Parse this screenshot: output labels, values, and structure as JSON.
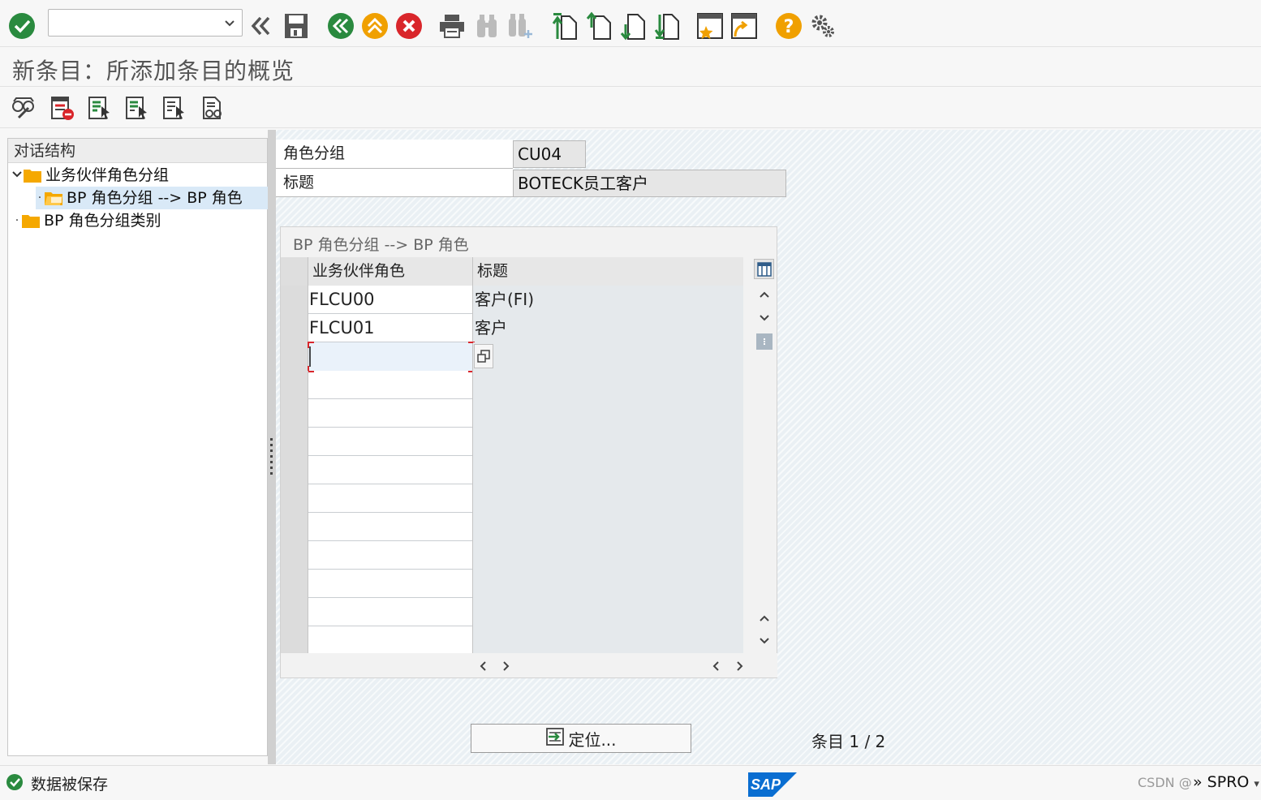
{
  "window": {
    "title": "新条目：所添加条目的概览"
  },
  "command_field": {
    "value": ""
  },
  "toolbar": {
    "icons": [
      "enter-icon",
      "back-double-icon",
      "save-icon",
      "back-icon",
      "exit-icon",
      "cancel-icon",
      "print-icon",
      "find-icon",
      "find-next-icon",
      "first-page-icon",
      "previous-page-icon",
      "next-page-icon",
      "last-page-icon",
      "create-session-icon",
      "generate-shortcut-icon",
      "help-icon",
      "settings-icon"
    ]
  },
  "app_toolbar": {
    "icons": [
      "display-change-icon",
      "delete-icon",
      "select-all-icon",
      "select-block-icon",
      "deselect-all-icon",
      "print-preview-icon"
    ]
  },
  "nav": {
    "header": "对话结构",
    "items": [
      {
        "label": "业务伙伴角色分组",
        "level": 0,
        "expanded": true
      },
      {
        "label": "BP 角色分组 --> BP 角色",
        "level": 1,
        "selected": true
      },
      {
        "label": "BP 角色分组类别",
        "level": 0
      }
    ]
  },
  "header_fields": {
    "role_group_label": "角色分组",
    "role_group_value": "CU04",
    "title_label": "标题",
    "title_value": "BOTECK员工客户"
  },
  "table": {
    "caption": "BP 角色分组 --> BP 角色",
    "columns": [
      "业务伙伴角色",
      "标题"
    ],
    "rows": [
      [
        "FLCU00",
        "客户(FI)"
      ],
      [
        "FLCU01",
        "客户"
      ]
    ]
  },
  "footer": {
    "position_button": "定位...",
    "entry_label": "条目",
    "entry_value": "1 / 2"
  },
  "status": {
    "message": "数据被保存",
    "tcode": "SPRO",
    "watermark": "CSDN @"
  },
  "colors": {
    "green": "#2a8a3f",
    "orange": "#f0a000",
    "red": "#d9262b",
    "folder": "#f5a800",
    "selection": "#d9e9f7"
  }
}
